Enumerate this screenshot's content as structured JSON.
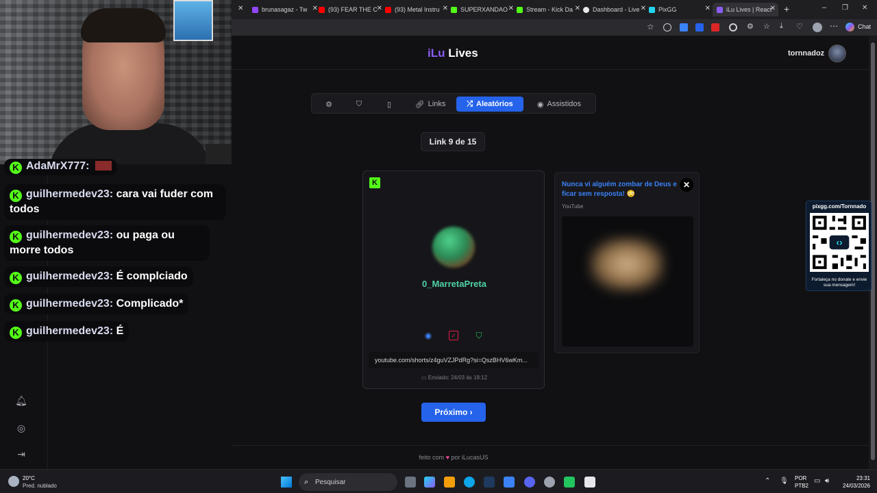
{
  "browser": {
    "tabs": [
      {
        "label": "brunasagaz - Tw",
        "color": "#9146ff"
      },
      {
        "label": "(93) FEAR THE C",
        "color": "#ff0000"
      },
      {
        "label": "(93) Metal Instru",
        "color": "#ff0000"
      },
      {
        "label": "SUPERXANDAO",
        "color": "#53fc18"
      },
      {
        "label": "Stream - Kick Da",
        "color": "#53fc18"
      },
      {
        "label": "Dashboard - Live",
        "color": "#e8e8ec"
      },
      {
        "label": "PixGG",
        "color": "#22d3ee"
      },
      {
        "label": "iLu Lives | React",
        "color": "#8b5cf6"
      }
    ],
    "new_tab": "+",
    "chat_button": "Chat"
  },
  "stream_chat": {
    "messages": [
      {
        "user": "AdaMrX777:",
        "text": ""
      },
      {
        "user": "guilhermedev23:",
        "text": "cara vai fuder com todos"
      },
      {
        "user": "guilhermedev23:",
        "text": "ou paga ou morre todos"
      },
      {
        "user": "guilhermedev23:",
        "text": "É complciado"
      },
      {
        "user": "guilhermedev23:",
        "text": "Complicado*"
      },
      {
        "user": "guilhermedev23:",
        "text": "É"
      }
    ]
  },
  "app": {
    "logo_prefix": "iLu",
    "logo_suffix": "Lives",
    "username": "tornnadoz",
    "nav_tabs": [
      {
        "label": "",
        "icon": "gear-icon"
      },
      {
        "label": "",
        "icon": "shield-icon"
      },
      {
        "label": "",
        "icon": "bookmark-icon"
      },
      {
        "label": "Links",
        "icon": "link-icon"
      },
      {
        "label": "Aleatórios",
        "icon": "shuffle-icon",
        "active": true
      },
      {
        "label": "Assistidos",
        "icon": "eye-icon"
      }
    ],
    "counter": "Link 9 de 15",
    "card": {
      "platform_badge": "K",
      "name": "0_MarretaPreta",
      "url": "youtube.com/shorts/z4guVZJPdRg?si=QszBHV6wKm...",
      "sent": "Enviado: 24/03 às 18:12"
    },
    "preview": {
      "title": "Nunca vi alguém zombar de Deus e ficar sem resposta! 😳",
      "source": "YouTube",
      "close": "✕"
    },
    "next_button": "Próximo ›",
    "footer_prefix": "feito com",
    "footer_heart": "♥",
    "footer_suffix": "por iLucasUS"
  },
  "qr_widget": {
    "title": "pixgg.com/Tornnado",
    "note": "Fortaleça no donate e envie sua mensagem!"
  },
  "taskbar": {
    "temperature": "20°C",
    "weather": "Pred. nublado",
    "search_placeholder": "Pesquisar",
    "lang": "POR",
    "layout": "PTB2",
    "time": "23:31",
    "date": "24/03/2026"
  },
  "colors": {
    "accent": "#2563eb",
    "kick_green": "#53fc18",
    "logo_purple": "#8b5cf6"
  }
}
